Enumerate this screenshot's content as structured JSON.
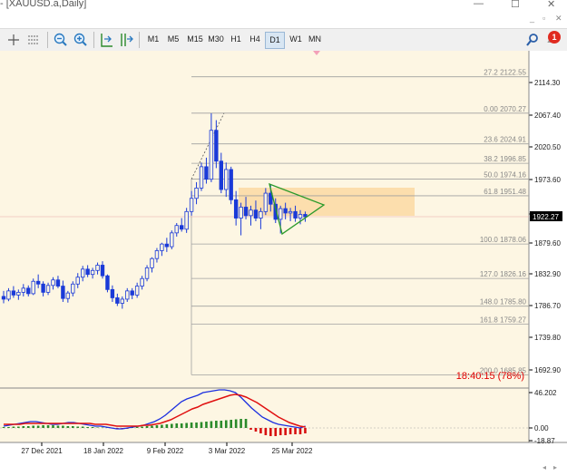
{
  "window": {
    "title": "- [XAUUSD.a,Daily]",
    "minimize": "—",
    "maximize": "☐",
    "close": "✕",
    "sub_minimize": "_",
    "sub_restore": "▫",
    "sub_close": "✕"
  },
  "toolbar": {
    "timeframes": [
      "M1",
      "M5",
      "M15",
      "M30",
      "H1",
      "H4",
      "D1",
      "W1",
      "MN"
    ],
    "selected_timeframe": "D1",
    "notification_count": "1"
  },
  "chart": {
    "symbol": "XAUUSD.a",
    "period": "Daily",
    "price_axis": [
      "2114.30",
      "2067.40",
      "2020.50",
      "1973.60",
      "1926.70",
      "1879.60",
      "1832.90",
      "1786.70",
      "1739.80",
      "1692.90"
    ],
    "current_price": "1922.27",
    "timer": "18:40:15 (78%)",
    "date_labels": [
      "27 Dec 2021",
      "18 Jan 2022",
      "9 Feb 2022",
      "3 Mar 2022",
      "25 Mar 2022"
    ],
    "fib_levels": [
      {
        "label": "27.2  2122.55"
      },
      {
        "label": "0.00  2070.27"
      },
      {
        "label": "23.6  2024.91"
      },
      {
        "label": "38.2  1996.85"
      },
      {
        "label": "50.0  1974.16"
      },
      {
        "label": "61.8  1951.48"
      },
      {
        "label": "100.0  1878.06"
      },
      {
        "label": "127.0  1826.16"
      },
      {
        "label": "148.0  1785.80"
      },
      {
        "label": "161.8  1759.27"
      },
      {
        "label": "200.0  1685.85"
      }
    ],
    "indicator_axis": [
      "46.202",
      "0.00",
      "-18.87"
    ],
    "colors": {
      "background": "#fdf6e3",
      "bull": "#1a3ad8",
      "bear": "#1a3ad8",
      "fib": "#a0a0a0",
      "zone": "#fcd9a3",
      "triangle": "#2a9a2a",
      "timer": "#e00000",
      "macd_fast": "#1c2fe0",
      "macd_slow": "#e01010",
      "hist_pos": "#2a8a2a",
      "hist_neg": "#d81010"
    }
  }
}
